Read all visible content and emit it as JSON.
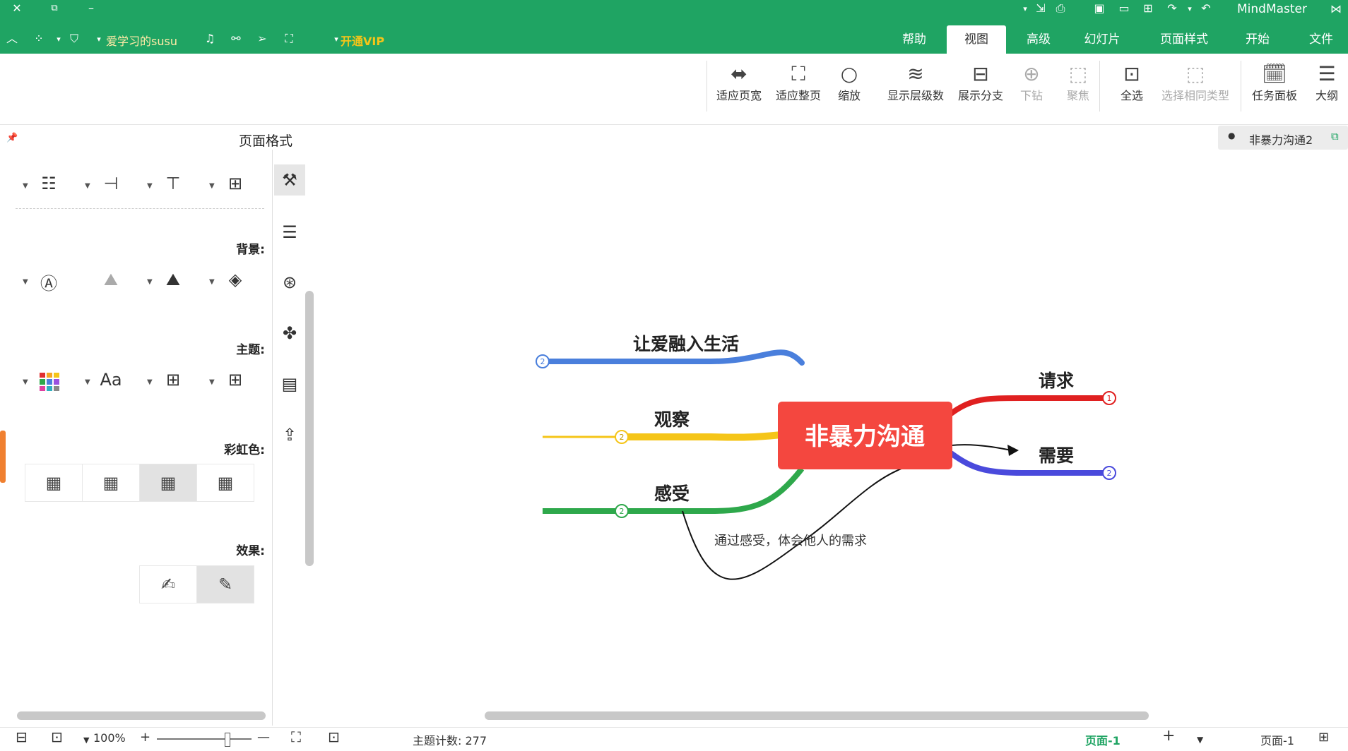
{
  "app": {
    "name": "MindMaster"
  },
  "menu": {
    "tabs": [
      {
        "label": "文件"
      },
      {
        "label": "开始"
      },
      {
        "label": "页面样式"
      },
      {
        "label": "幻灯片"
      },
      {
        "label": "高级"
      },
      {
        "label": "视图"
      },
      {
        "label": "帮助"
      }
    ],
    "active_tab": "视图",
    "vip_label": "开通VIP",
    "user_label": "爱学习的susu"
  },
  "ribbon": {
    "buttons": [
      {
        "label": "大纲",
        "icon": "outline-icon"
      },
      {
        "label": "任务面板",
        "icon": "task-panel-icon"
      },
      {
        "label": "选择相同类型",
        "icon": "select-same-icon"
      },
      {
        "label": "全选",
        "icon": "select-all-icon"
      },
      {
        "label": "聚焦",
        "icon": "focus-icon"
      },
      {
        "label": "下钻",
        "icon": "drill-down-icon"
      },
      {
        "label": "展示分支",
        "icon": "show-branch-icon"
      },
      {
        "label": "显示层级数",
        "icon": "layers-icon"
      },
      {
        "label": "缩放",
        "icon": "zoom-icon"
      },
      {
        "label": "适应整页",
        "icon": "fit-page-icon"
      },
      {
        "label": "适应页宽",
        "icon": "fit-width-icon"
      }
    ]
  },
  "document": {
    "tab_title": "非暴力沟通2"
  },
  "panel": {
    "title": "页面格式",
    "sections": {
      "background": "背景:",
      "theme": "主题:",
      "rainbow": "彩虹色:",
      "effect": "效果:"
    },
    "theme_font_label": "Aa"
  },
  "mindmap": {
    "central": "非暴力沟通",
    "branches": [
      {
        "label": "让爱融入生活",
        "number": "2",
        "color": "#4a7fdc"
      },
      {
        "label": "观察",
        "number": "2",
        "color": "#f5c518"
      },
      {
        "label": "感受",
        "number": "2",
        "color": "#2ea84b"
      },
      {
        "label": "请求",
        "number": "1",
        "color": "#e02020"
      },
      {
        "label": "需要",
        "number": "2",
        "color": "#4a4adc"
      }
    ],
    "relationship_label": "通过感受，体会他人的需求",
    "colors": {
      "central_bg": "#f4473f",
      "central_text": "#ffffff"
    }
  },
  "status": {
    "page_label": "页面-1",
    "page_active": "页面-1",
    "topic_count": "主题计数: 277",
    "zoom": "100%"
  }
}
